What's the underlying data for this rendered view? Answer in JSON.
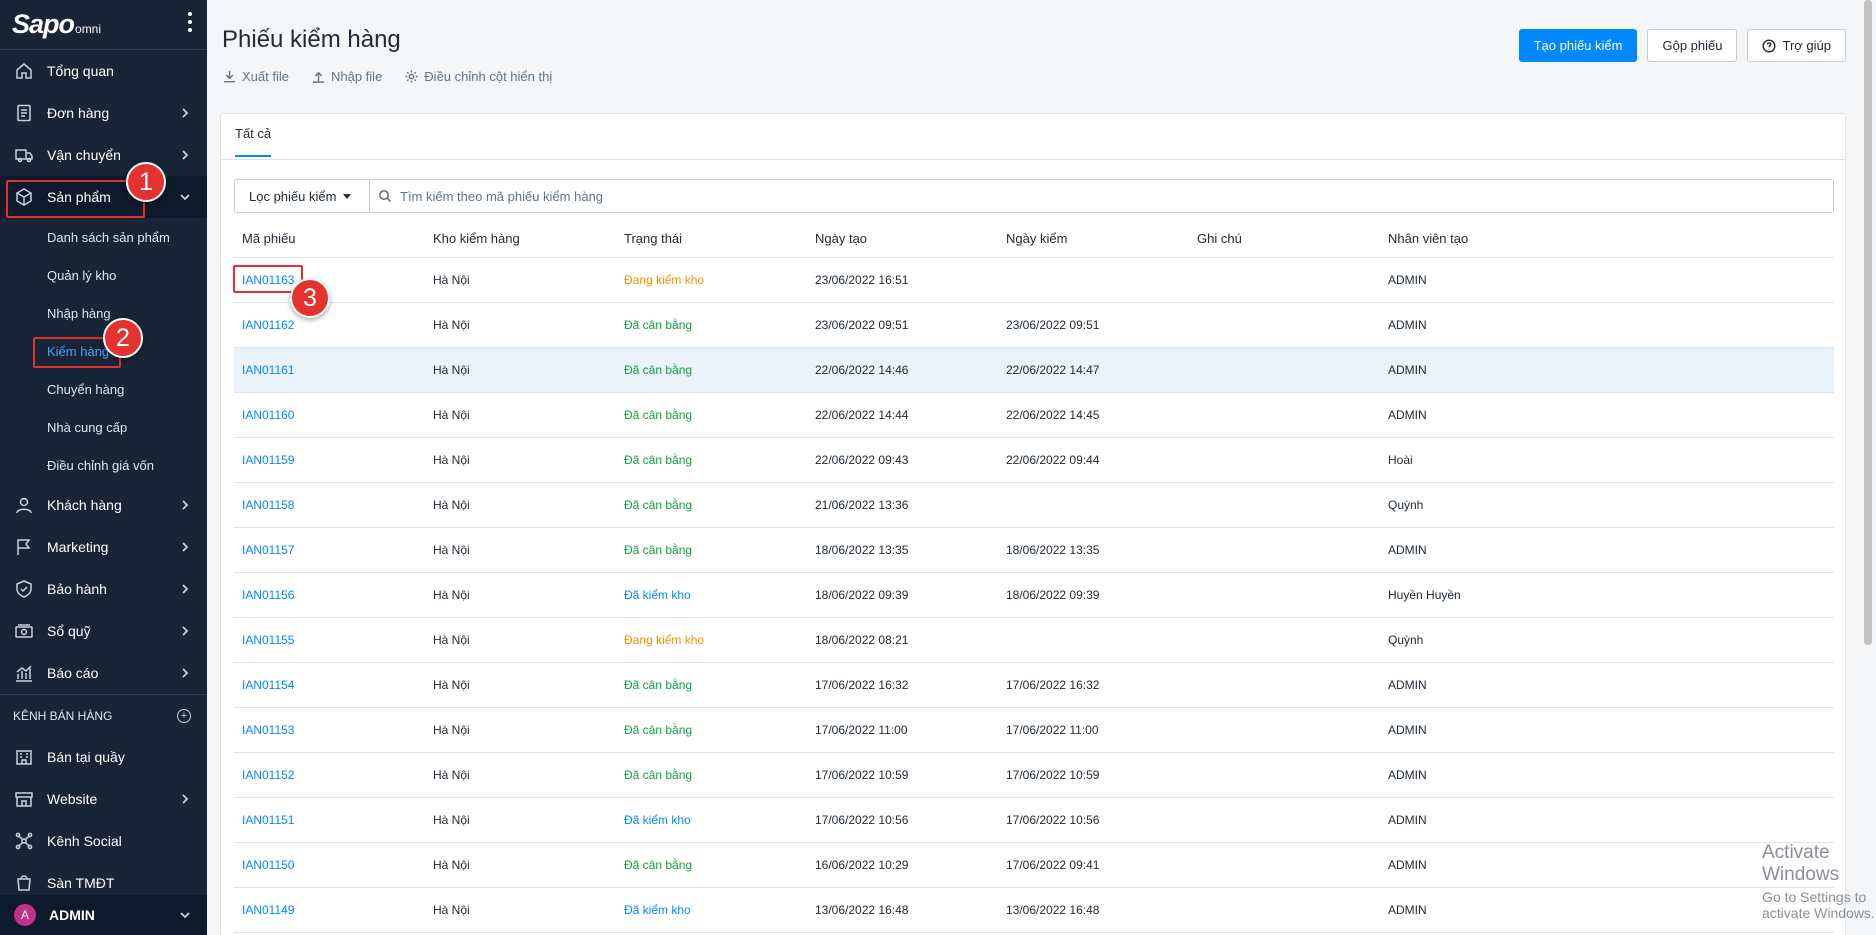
{
  "brand": {
    "logo": "Sapo",
    "logo_sub": "omni"
  },
  "sidebar": {
    "items": [
      {
        "label": "Tổng quan",
        "icon": "home-icon"
      },
      {
        "label": "Đơn hàng",
        "icon": "order-icon"
      },
      {
        "label": "Vận chuyển",
        "icon": "truck-icon"
      },
      {
        "label": "Sản phẩm",
        "icon": "box-icon"
      },
      {
        "label": "Khách hàng",
        "icon": "user-icon"
      },
      {
        "label": "Marketing",
        "icon": "flag-icon"
      },
      {
        "label": "Bảo hành",
        "icon": "shield-icon"
      },
      {
        "label": "Sổ quỹ",
        "icon": "cash-icon"
      },
      {
        "label": "Báo cáo",
        "icon": "chart-icon"
      }
    ],
    "product_sub": [
      "Danh sách sản phẩm",
      "Quản lý kho",
      "Nhập hàng",
      "Kiểm hàng",
      "Chuyển hàng",
      "Nhà cung cấp",
      "Điều chỉnh giá vốn"
    ],
    "channels_header": "KÊNH BÁN HÀNG",
    "channels": [
      {
        "label": "Bán tại quầy",
        "icon": "store-icon"
      },
      {
        "label": "Website",
        "icon": "website-icon"
      },
      {
        "label": "Kênh Social",
        "icon": "social-icon"
      },
      {
        "label": "Sàn TMĐT",
        "icon": "marketplace-icon"
      }
    ],
    "user": {
      "initial": "A",
      "name": "ADMIN"
    }
  },
  "header": {
    "title": "Phiếu kiểm hàng",
    "export_label": "Xuất file",
    "import_label": "Nhập file",
    "columns_label": "Điều chỉnh cột hiển thị",
    "create_button": "Tạo phiếu kiểm",
    "merge_button": "Gộp phiếu",
    "help_button": "Trợ giúp"
  },
  "tabs": {
    "all": "Tất cả"
  },
  "filter": {
    "label": "Lọc phiếu kiểm",
    "search_placeholder": "Tìm kiếm theo mã phiếu kiểm hàng"
  },
  "table": {
    "columns": [
      "Mã phiếu",
      "Kho kiểm hàng",
      "Trạng thái",
      "Ngày tạo",
      "Ngày kiểm",
      "Ghi chú",
      "Nhân viên tạo"
    ],
    "rows": [
      {
        "code": "IAN01163",
        "warehouse": "Hà Nội",
        "status": "Đang kiểm kho",
        "status_type": "orange",
        "created": "23/06/2022 16:51",
        "checked": "",
        "note": "",
        "staff": "ADMIN"
      },
      {
        "code": "IAN01162",
        "warehouse": "Hà Nội",
        "status": "Đã cân bằng",
        "status_type": "green",
        "created": "23/06/2022 09:51",
        "checked": "23/06/2022 09:51",
        "note": "",
        "staff": "ADMIN"
      },
      {
        "code": "IAN01161",
        "warehouse": "Hà Nội",
        "status": "Đã cân bằng",
        "status_type": "green",
        "created": "22/06/2022 14:46",
        "checked": "22/06/2022 14:47",
        "note": "",
        "staff": "ADMIN"
      },
      {
        "code": "IAN01160",
        "warehouse": "Hà Nội",
        "status": "Đã cân bằng",
        "status_type": "green",
        "created": "22/06/2022 14:44",
        "checked": "22/06/2022 14:45",
        "note": "",
        "staff": "ADMIN"
      },
      {
        "code": "IAN01159",
        "warehouse": "Hà Nội",
        "status": "Đã cân bằng",
        "status_type": "green",
        "created": "22/06/2022 09:43",
        "checked": "22/06/2022 09:44",
        "note": "",
        "staff": "Hoài"
      },
      {
        "code": "IAN01158",
        "warehouse": "Hà Nội",
        "status": "Đã cân bằng",
        "status_type": "green",
        "created": "21/06/2022 13:36",
        "checked": "",
        "note": "",
        "staff": "Quỳnh"
      },
      {
        "code": "IAN01157",
        "warehouse": "Hà Nội",
        "status": "Đã cân bằng",
        "status_type": "green",
        "created": "18/06/2022 13:35",
        "checked": "18/06/2022 13:35",
        "note": "",
        "staff": "ADMIN"
      },
      {
        "code": "IAN01156",
        "warehouse": "Hà Nội",
        "status": "Đã kiểm kho",
        "status_type": "blue",
        "created": "18/06/2022 09:39",
        "checked": "18/06/2022 09:39",
        "note": "",
        "staff": "Huyền Huyền"
      },
      {
        "code": "IAN01155",
        "warehouse": "Hà Nội",
        "status": "Đang kiểm kho",
        "status_type": "orange",
        "created": "18/06/2022 08:21",
        "checked": "",
        "note": "",
        "staff": "Quỳnh"
      },
      {
        "code": "IAN01154",
        "warehouse": "Hà Nội",
        "status": "Đã cân bằng",
        "status_type": "green",
        "created": "17/06/2022 16:32",
        "checked": "17/06/2022 16:32",
        "note": "",
        "staff": "ADMIN"
      },
      {
        "code": "IAN01153",
        "warehouse": "Hà Nội",
        "status": "Đã cân bằng",
        "status_type": "green",
        "created": "17/06/2022 11:00",
        "checked": "17/06/2022 11:00",
        "note": "",
        "staff": "ADMIN"
      },
      {
        "code": "IAN01152",
        "warehouse": "Hà Nội",
        "status": "Đã cân bằng",
        "status_type": "green",
        "created": "17/06/2022 10:59",
        "checked": "17/06/2022 10:59",
        "note": "",
        "staff": "ADMIN"
      },
      {
        "code": "IAN01151",
        "warehouse": "Hà Nội",
        "status": "Đã kiểm kho",
        "status_type": "blue",
        "created": "17/06/2022 10:56",
        "checked": "17/06/2022 10:56",
        "note": "",
        "staff": "ADMIN"
      },
      {
        "code": "IAN01150",
        "warehouse": "Hà Nội",
        "status": "Đã cân bằng",
        "status_type": "green",
        "created": "16/06/2022 10:29",
        "checked": "17/06/2022 09:41",
        "note": "",
        "staff": "ADMIN"
      },
      {
        "code": "IAN01149",
        "warehouse": "Hà Nội",
        "status": "Đã kiểm kho",
        "status_type": "blue",
        "created": "13/06/2022 16:48",
        "checked": "13/06/2022 16:48",
        "note": "",
        "staff": "ADMIN"
      }
    ]
  },
  "annotations": [
    "1",
    "2",
    "3"
  ],
  "watermark": {
    "line1": "Activate Windows",
    "line2": "Go to Settings to activate Windows."
  },
  "colors": {
    "sidebar_bg": "#182537",
    "primary": "#0088FF",
    "status_green": "#0FA23F",
    "status_orange": "#F49000",
    "annotation_red": "#E4332E"
  }
}
